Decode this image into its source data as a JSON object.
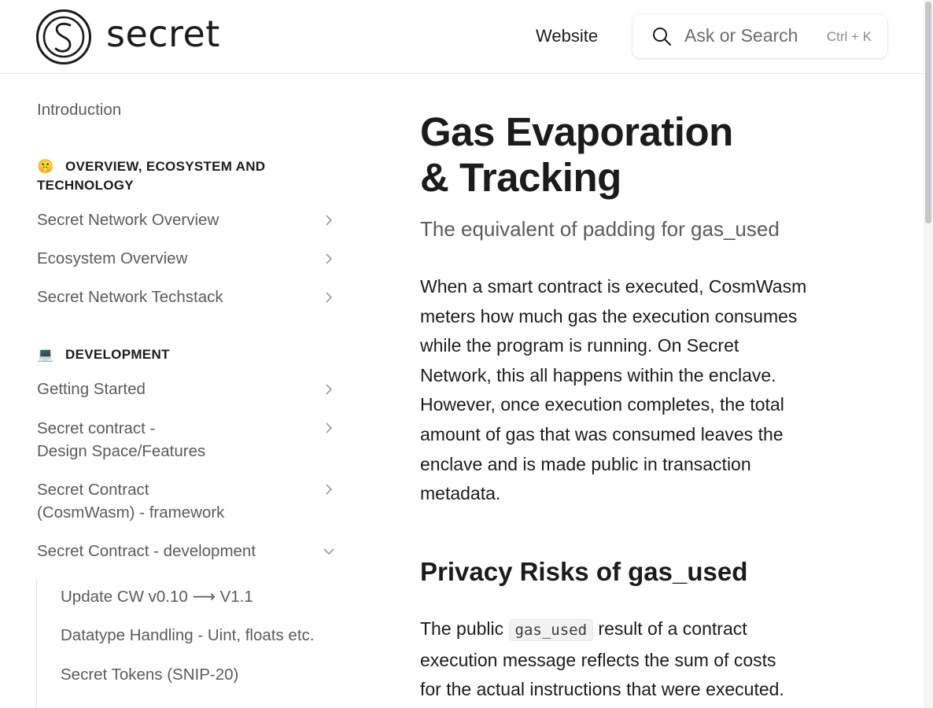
{
  "header": {
    "logo_text": "secret",
    "website_label": "Website",
    "search_placeholder": "Ask or Search",
    "search_shortcut": "Ctrl + K"
  },
  "sidebar": {
    "introduction": "Introduction",
    "section_overview": {
      "emoji": "🤫",
      "title_line1": "OVERVIEW, ECOSYSTEM AND",
      "title_line2": "TECHNOLOGY"
    },
    "overview_items": [
      {
        "label": "Secret Network Overview"
      },
      {
        "label": "Ecosystem Overview"
      },
      {
        "label": "Secret Network Techstack"
      }
    ],
    "section_development": {
      "emoji": "💻",
      "title": "DEVELOPMENT"
    },
    "development_items": [
      {
        "label_line1": "Getting Started",
        "label_line2": ""
      },
      {
        "label_line1": "Secret contract -",
        "label_line2": "Design Space/Features"
      },
      {
        "label_line1": "Secret Contract",
        "label_line2": "(CosmWasm) - framework"
      },
      {
        "label_line1": "Secret Contract - development",
        "label_line2": ""
      }
    ],
    "sub_items": [
      {
        "label": "Update CW v0.10 ⟶ V1.1"
      },
      {
        "label": "Datatype Handling - Uint, floats etc."
      },
      {
        "label": "Secret Tokens (SNIP-20)"
      }
    ]
  },
  "main": {
    "title_line1": "Gas Evaporation",
    "title_line2": "& Tracking",
    "subtitle": "The equivalent of padding for gas_used",
    "para1_lines": [
      "When a smart contract is executed, CosmWasm",
      "meters how much gas the execution consumes",
      "while the program is running. On Secret",
      "Network, this all happens within the enclave.",
      "However, once execution completes, the total",
      "amount of gas that was consumed leaves the",
      "enclave and is made public in transaction",
      "metadata."
    ],
    "h2": "Privacy Risks of gas_used",
    "para2_prefix": "The public ",
    "para2_code": "gas_used",
    "para2_suffix": " result of a contract",
    "para2_lines": [
      "execution message reflects the sum of costs",
      "for the actual instructions that were executed."
    ]
  }
}
